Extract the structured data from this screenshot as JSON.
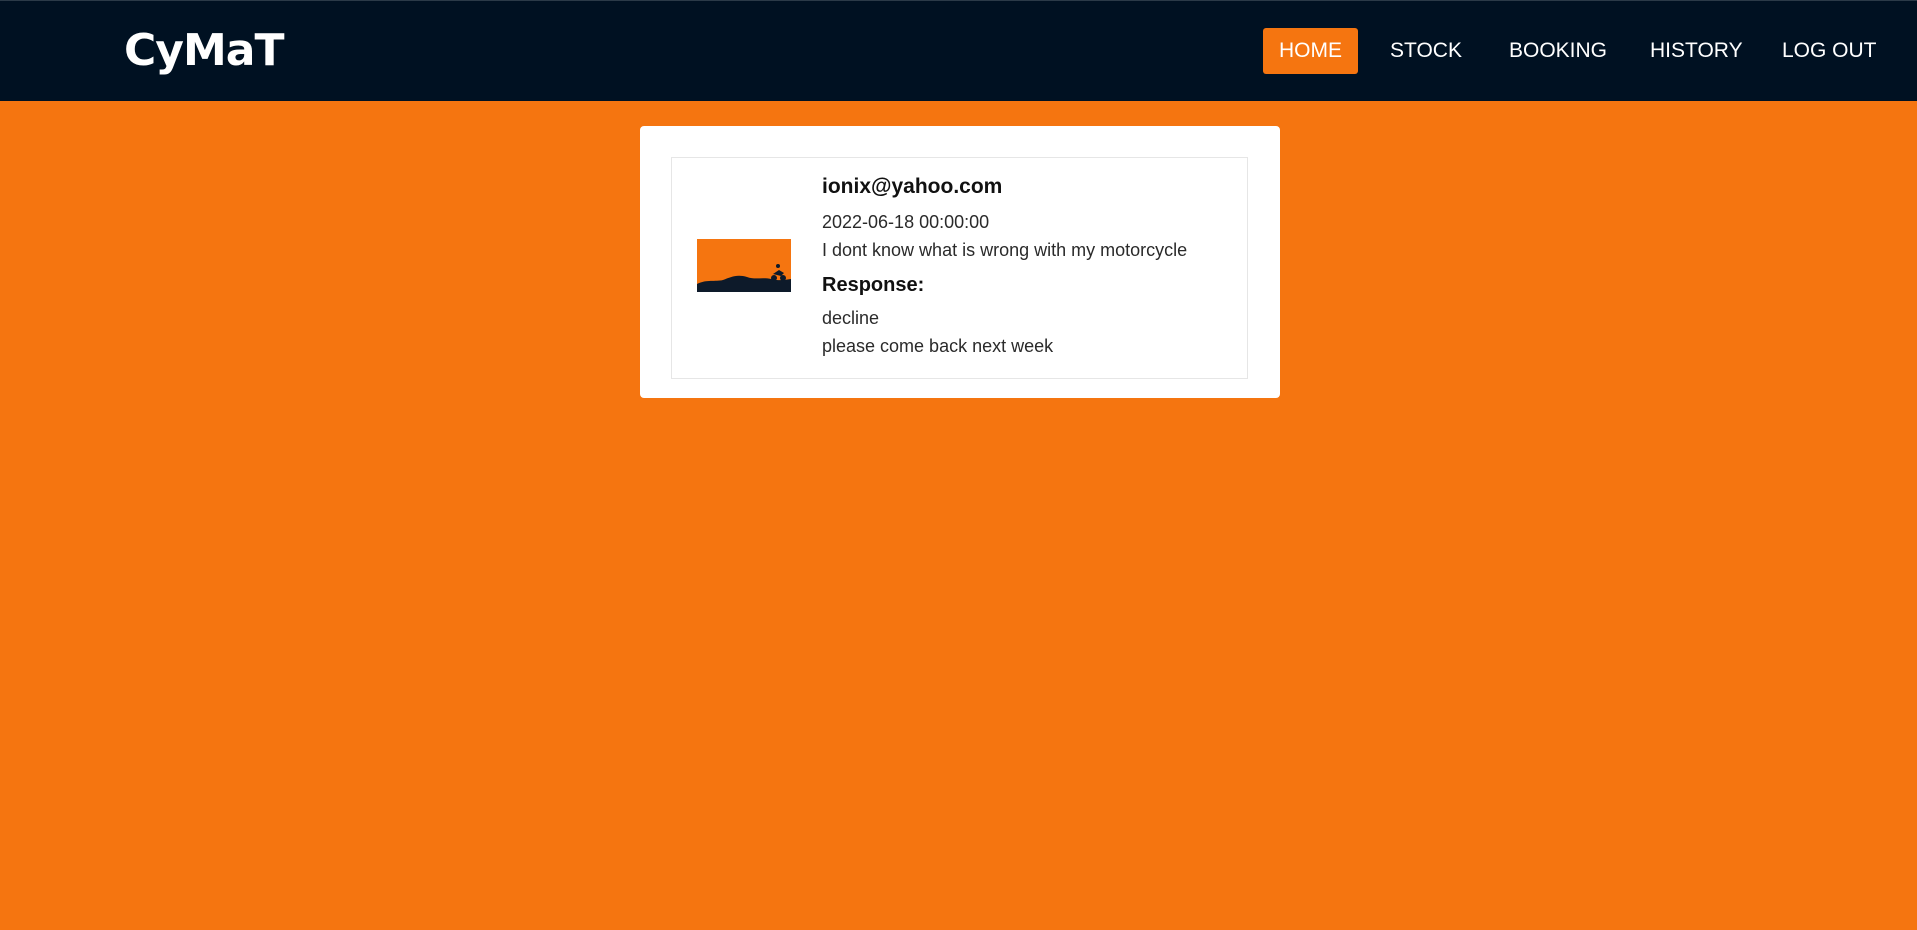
{
  "brand": "CyMaT",
  "nav": {
    "home": "HOME",
    "stock": "STOCK",
    "booking": "BOOKING",
    "history": "HISTORY",
    "logout": "LOG OUT"
  },
  "entry": {
    "email": "ionix@yahoo.com",
    "datetime": "2022-06-18 00:00:00",
    "message": "I dont know what is wrong with my motorcycle",
    "response_label": "Response:",
    "response_status": "decline",
    "response_text": "please come back next week"
  },
  "colors": {
    "accent": "#f57510",
    "navbar": "#001122",
    "card": "#ffffff"
  }
}
